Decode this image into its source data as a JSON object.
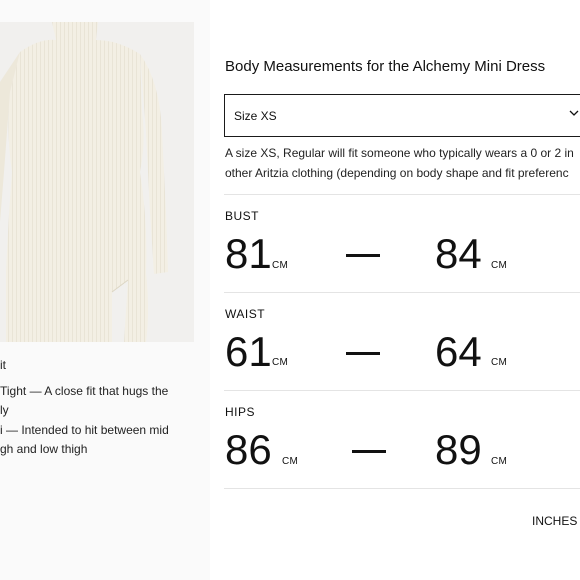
{
  "product": {
    "fit_lines": [
      "it",
      "Tight — A close fit that hugs the",
      "ly",
      "i — Intended to hit between mid",
      "gh and low thigh"
    ]
  },
  "modal": {
    "title": "Body Measurements for the Alchemy Mini Dress",
    "size_select": {
      "value": "Size XS",
      "icon": "chevron-down-icon"
    },
    "description_lines": [
      "A size XS, Regular will fit someone who typically wears a 0 or 2 in",
      "other Aritzia clothing (depending on body shape and fit preferenc"
    ],
    "measurements": [
      {
        "label": "BUST",
        "min": "81",
        "max": "84",
        "unit": "CM"
      },
      {
        "label": "WAIST",
        "min": "61",
        "max": "64",
        "unit": "CM"
      },
      {
        "label": "HIPS",
        "min": "86",
        "max": "89",
        "unit": "CM"
      }
    ],
    "unit_toggle": "INCHES"
  },
  "colors": {
    "dress": "#f2eee3",
    "image_bg": "#f1f0ee",
    "text": "#111111",
    "divider": "#e4e4e4"
  }
}
